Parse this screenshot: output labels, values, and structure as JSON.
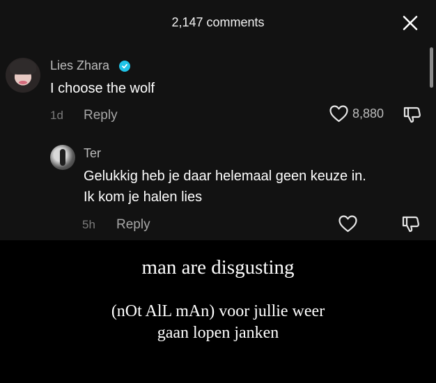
{
  "header": {
    "title": "2,147 comments",
    "close_icon": "close-icon"
  },
  "comment": {
    "username": "Lies Zhara",
    "verified_icon": "verified-badge-icon",
    "text": "I choose the wolf",
    "time": "1d",
    "reply_label": "Reply",
    "like_count": "8,880",
    "like_icon": "heart-icon",
    "dislike_icon": "thumbs-down-icon"
  },
  "reply": {
    "username": "Ter",
    "text_line1": "Gelukkig heb je daar helemaal geen keuze in.",
    "text_line2": "Ik kom je halen lies",
    "time": "5h",
    "reply_label": "Reply",
    "like_icon": "heart-icon",
    "dislike_icon": "thumbs-down-icon"
  },
  "caption": {
    "line1": "man are disgusting",
    "line2": "(nOt AlL mAn) voor jullie weer",
    "line3": "gaan lopen janken"
  },
  "colors": {
    "panel_bg": "#121212",
    "page_bg": "#000000",
    "verified": "#20c4e8"
  }
}
